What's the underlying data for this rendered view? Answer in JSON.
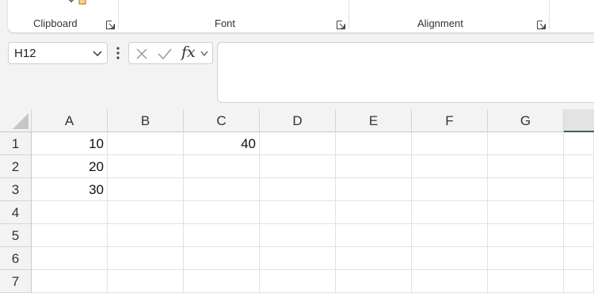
{
  "ribbon": {
    "groups": [
      {
        "label": "Clipboard"
      },
      {
        "label": "Font"
      },
      {
        "label": "Alignment"
      }
    ]
  },
  "formula_bar": {
    "name_box": "H12",
    "fx_label": "fx",
    "formula": ""
  },
  "sheet": {
    "columns": [
      "A",
      "B",
      "C",
      "D",
      "E",
      "F",
      "G",
      ""
    ],
    "rows": [
      "1",
      "2",
      "3",
      "4",
      "5",
      "6",
      "7"
    ],
    "cells": [
      [
        "10",
        "",
        "40",
        "",
        "",
        "",
        "",
        ""
      ],
      [
        "20",
        "",
        "",
        "",
        "",
        "",
        "",
        ""
      ],
      [
        "30",
        "",
        "",
        "",
        "",
        "",
        "",
        ""
      ],
      [
        "",
        "",
        "",
        "",
        "",
        "",
        "",
        ""
      ],
      [
        "",
        "",
        "",
        "",
        "",
        "",
        "",
        ""
      ],
      [
        "",
        "",
        "",
        "",
        "",
        "",
        "",
        ""
      ],
      [
        "",
        "",
        "",
        "",
        "",
        "",
        "",
        ""
      ]
    ]
  },
  "colors": {
    "accent": "#217346",
    "background": "#f3f3f3"
  }
}
